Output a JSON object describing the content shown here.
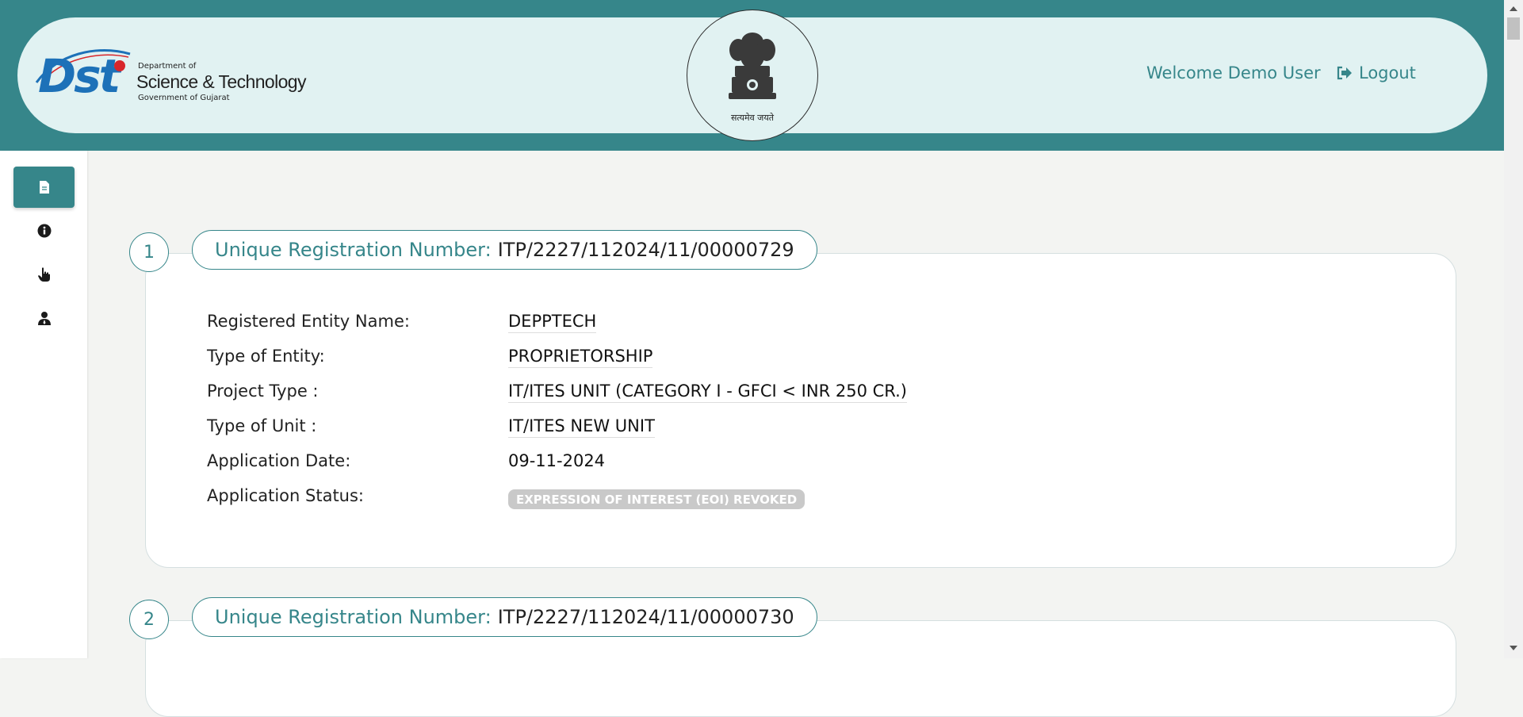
{
  "header": {
    "logo": {
      "brand": "Dst",
      "dept_line": "Department of",
      "name_line": "Science & Technology",
      "gov_line": "Government of Gujarat"
    },
    "emblem_text": "सत्यमेव जयते",
    "welcome": "Welcome Demo User",
    "logout_label": "Logout"
  },
  "sidebar": {
    "items": [
      {
        "icon": "document-icon",
        "active": true
      },
      {
        "icon": "info-icon",
        "active": false
      },
      {
        "icon": "hand-pointer-icon",
        "active": false
      },
      {
        "icon": "user-tie-icon",
        "active": false
      }
    ]
  },
  "applications": [
    {
      "number": "1",
      "urn_label": "Unique Registration Number:",
      "urn": "ITP/2227/112024/11/00000729",
      "fields": [
        {
          "label": "Registered Entity Name:",
          "value": "DEPPTECH"
        },
        {
          "label": "Type of Entity:",
          "value": "PROPRIETORSHIP"
        },
        {
          "label": "Project Type :",
          "value": "IT/ITES UNIT (CATEGORY I - GFCI < INR 250 CR.)"
        },
        {
          "label": "Type of Unit :",
          "value": "IT/ITES NEW UNIT"
        },
        {
          "label": "Application Date:",
          "value": "09-11-2024"
        }
      ],
      "status_label": "Application Status:",
      "status": "EXPRESSION OF INTEREST (EOI) REVOKED"
    },
    {
      "number": "2",
      "urn_label": "Unique Registration Number:",
      "urn": "ITP/2227/112024/11/00000730"
    }
  ],
  "colors": {
    "primary": "#36868a",
    "header_bg": "#e1f2f2",
    "status_badge": "#c9c9c9"
  }
}
